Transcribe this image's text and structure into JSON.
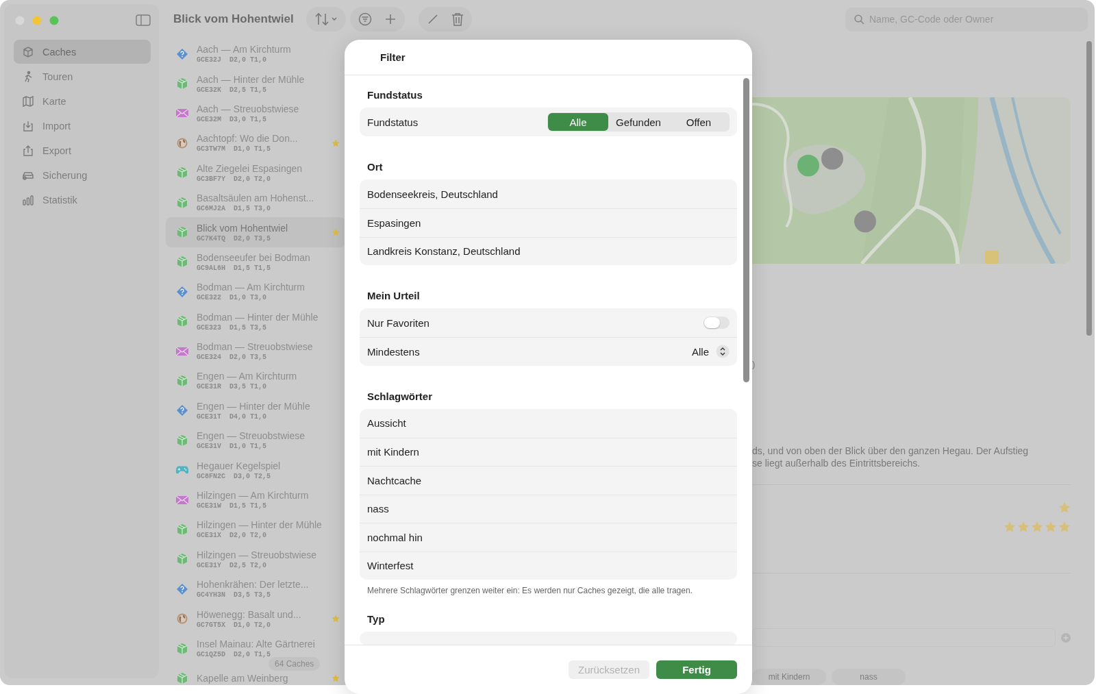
{
  "sidebar": {
    "items": [
      {
        "label": "Caches",
        "selected": true
      },
      {
        "label": "Touren",
        "selected": false
      },
      {
        "label": "Karte",
        "selected": false
      },
      {
        "label": "Import",
        "selected": false
      },
      {
        "label": "Export",
        "selected": false
      },
      {
        "label": "Sicherung",
        "selected": false
      },
      {
        "label": "Statistik",
        "selected": false
      }
    ]
  },
  "toolbar": {
    "title": "Blick vom Hohentwiel",
    "search": {
      "placeholder": "Name, GC-Code oder Owner"
    }
  },
  "cache_list": {
    "count": "64 Caches",
    "items": [
      {
        "kind": "mystery",
        "title": "Aach — Am Kirchturm",
        "code": "GCE32J  D2,0 T1,0",
        "favorite": false,
        "selected": false
      },
      {
        "kind": "traditional",
        "title": "Aach — Hinter der Mühle",
        "code": "GCE32K  D2,5 T1,5",
        "favorite": false,
        "selected": false
      },
      {
        "kind": "letterbox",
        "title": "Aach — Streuobstwiese",
        "code": "GCE32M  D3,0 T1,5",
        "favorite": false,
        "selected": false
      },
      {
        "kind": "earth",
        "title": "Aachtopf: Wo die Don...",
        "code": "GC3TW7M  D1,0 T1,5",
        "favorite": true,
        "selected": false
      },
      {
        "kind": "traditional",
        "title": "Alte Ziegelei Espasingen",
        "code": "GC3BF7Y  D2,0 T2,0",
        "favorite": false,
        "selected": false
      },
      {
        "kind": "traditional",
        "title": "Basaltsäulen am Hohenst...",
        "code": "GC6MJ2A  D1,5 T3,0",
        "favorite": false,
        "selected": false
      },
      {
        "kind": "traditional",
        "title": "Blick vom Hohentwiel",
        "code": "GC7K4TQ  D2,0 T3,5",
        "favorite": true,
        "selected": true
      },
      {
        "kind": "traditional",
        "title": "Bodenseeufer bei Bodman",
        "code": "GC9AL6H  D1,5 T1,5",
        "favorite": false,
        "selected": false
      },
      {
        "kind": "mystery",
        "title": "Bodman — Am Kirchturm",
        "code": "GCE322  D1,0 T3,0",
        "favorite": false,
        "selected": false
      },
      {
        "kind": "traditional",
        "title": "Bodman — Hinter der Mühle",
        "code": "GCE323  D1,5 T3,5",
        "favorite": false,
        "selected": false
      },
      {
        "kind": "letterbox",
        "title": "Bodman — Streuobstwiese",
        "code": "GCE324  D2,0 T3,5",
        "favorite": false,
        "selected": false
      },
      {
        "kind": "traditional",
        "title": "Engen — Am Kirchturm",
        "code": "GCE31R  D3,5 T1,0",
        "favorite": false,
        "selected": false
      },
      {
        "kind": "mystery",
        "title": "Engen — Hinter der Mühle",
        "code": "GCE31T  D4,0 T1,0",
        "favorite": false,
        "selected": false
      },
      {
        "kind": "traditional",
        "title": "Engen — Streuobstwiese",
        "code": "GCE31V  D1,0 T1,5",
        "favorite": false,
        "selected": false
      },
      {
        "kind": "game",
        "title": "Hegauer Kegelspiel",
        "code": "GC8FN2C  D3,0 T2,5",
        "favorite": false,
        "selected": false
      },
      {
        "kind": "letterbox",
        "title": "Hilzingen — Am Kirchturm",
        "code": "GCE31W  D1,5 T1,5",
        "favorite": false,
        "selected": false
      },
      {
        "kind": "traditional",
        "title": "Hilzingen — Hinter der Mühle",
        "code": "GCE31X  D2,0 T2,0",
        "favorite": false,
        "selected": false
      },
      {
        "kind": "traditional",
        "title": "Hilzingen — Streuobstwiese",
        "code": "GCE31Y  D2,5 T2,0",
        "favorite": false,
        "selected": false
      },
      {
        "kind": "mystery",
        "title": "Hohenkrähen: Der letzte...",
        "code": "GC4YH3N  D3,5 T3,5",
        "favorite": false,
        "selected": false
      },
      {
        "kind": "earth",
        "title": "Höwenegg: Basalt und...",
        "code": "GC7GT5X  D1,0 T2,0",
        "favorite": true,
        "selected": false
      },
      {
        "kind": "traditional",
        "title": "Insel Mainau: Alte Gärtnerei",
        "code": "GC1QZ5D  D2,0 T1,5",
        "favorite": false,
        "selected": false
      },
      {
        "kind": "traditional",
        "title": "Kapelle am Weinberg",
        "favorite": true,
        "selected": false
      }
    ]
  },
  "detail": {
    "map": {
      "kind": "picture"
    },
    "fragment": ")",
    "description": [
      "ds, und von oben der Blick über den ganzen Hegau. Der Aufstieg",
      "se liegt außerhalb des Eintrittsbereichs."
    ],
    "favorite": true,
    "rating": {
      "stars": 5
    },
    "tags": [
      "mit Kindern",
      "nass"
    ]
  },
  "filter": {
    "title": "Filter",
    "sections": [
      {
        "kind": "segmented",
        "heading": "Fundstatus",
        "label": "Fundstatus",
        "options": [
          {
            "label": "Alle",
            "selected": true
          },
          {
            "label": "Gefunden",
            "selected": false
          },
          {
            "label": "Offen",
            "selected": false
          }
        ]
      },
      {
        "kind": "list",
        "heading": "Ort",
        "rows": [
          "Bodenseekreis, Deutschland",
          "Espasingen",
          "Landkreis Konstanz, Deutschland"
        ]
      },
      {
        "kind": "settings",
        "heading": "Mein Urteil",
        "rows": [
          {
            "kind": "toggle",
            "label": "Nur Favoriten",
            "on": false
          },
          {
            "kind": "picker",
            "label": "Mindestens",
            "value": "Alle"
          }
        ]
      },
      {
        "kind": "list",
        "heading": "Schlagwörter",
        "rows": [
          "Aussicht",
          "mit Kindern",
          "Nachtcache",
          "nass",
          "nochmal hin",
          "Winterfest"
        ],
        "note": "Mehrere Schlagwörter grenzen weiter ein: Es werden nur Caches gezeigt, die alle tragen."
      },
      {
        "kind": "list",
        "heading": "Typ"
      }
    ],
    "buttons": [
      {
        "kind": "secondary",
        "label": "Zurücksetzen",
        "disabled": true
      },
      {
        "kind": "primary",
        "label": "Fertig",
        "disabled": false
      }
    ]
  }
}
